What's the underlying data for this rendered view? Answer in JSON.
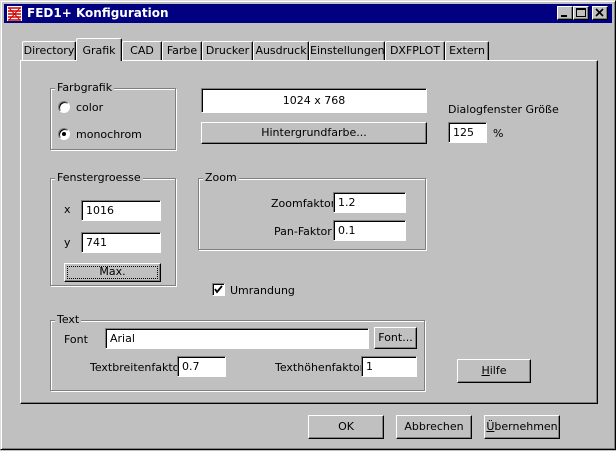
{
  "window": {
    "title": "FED1+ Konfiguration"
  },
  "tabs": [
    {
      "label": "Directory"
    },
    {
      "label": "Grafik",
      "active": true
    },
    {
      "label": "CAD"
    },
    {
      "label": "Farbe"
    },
    {
      "label": "Drucker"
    },
    {
      "label": "Ausdruck"
    },
    {
      "label": "Einstellungen"
    },
    {
      "label": "DXFPLOT"
    },
    {
      "label": "Extern"
    }
  ],
  "farbgrafik": {
    "label": "Farbgrafik",
    "options": [
      {
        "label": "color",
        "selected": false
      },
      {
        "label": "monochrom",
        "selected": true
      }
    ]
  },
  "resolution": {
    "value": "1024 x 768"
  },
  "background_button": {
    "label": "Hintergrundfarbe..."
  },
  "dialog_size": {
    "label": "Dialogfenster Größe",
    "value": "125",
    "unit": "%"
  },
  "fenstergroesse": {
    "label": "Fenstergroesse",
    "x_label": "x",
    "x_value": "1016",
    "y_label": "y",
    "y_value": "741",
    "max_button": "Max."
  },
  "zoom": {
    "label": "Zoom",
    "zoomfaktor_label": "Zoomfaktor",
    "zoomfaktor_value": "1.2",
    "panfaktor_label": "Pan-Faktor",
    "panfaktor_value": "0.1"
  },
  "umrandung": {
    "label": "Umrandung",
    "checked": true
  },
  "text_group": {
    "label": "Text",
    "font_label": "Font",
    "font_value": "Arial",
    "font_button": "Font...",
    "breiten_label": "Textbreitenfaktor",
    "breiten_value": "0.7",
    "hoehen_label": "Texthöhenfaktor",
    "hoehen_value": "1"
  },
  "help_button": {
    "prefix": "",
    "mnemonic": "H",
    "rest": "ilfe"
  },
  "footer": {
    "ok": "OK",
    "cancel": "Abbrechen",
    "apply_mnemonic": "Ü",
    "apply_rest": "bernehmen"
  },
  "colors": {
    "titlebar": "#000080",
    "face": "#c0c0c0"
  }
}
